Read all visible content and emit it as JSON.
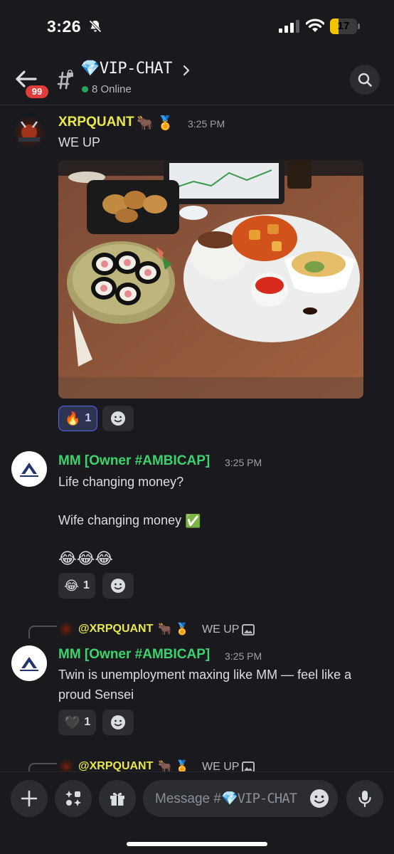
{
  "status_bar": {
    "time": "3:26",
    "battery_level": "17",
    "battery_fraction": 0.17
  },
  "header": {
    "unread_count": "99",
    "channel_name": "💎VIP-CHAT",
    "online_label": "8 Online"
  },
  "messages": [
    {
      "author": "XRPQUANT",
      "author_badges": "🐂 🏅",
      "time": "3:25 PM",
      "text": "WE UP",
      "attachment": "food-photo",
      "reactions": [
        {
          "emoji": "🔥",
          "count": "1",
          "active": true
        }
      ]
    },
    {
      "author": "MM [Owner #AMBICAP]",
      "time": "3:25 PM",
      "lines": [
        "Life changing money?",
        "Wife changing money",
        "😂😂😂"
      ],
      "line2_emoji": "✅",
      "reactions": [
        {
          "emoji": "😂",
          "count": "1",
          "active": false
        }
      ]
    },
    {
      "reply_to": {
        "author": "@XRPQUANT",
        "badges": "🐂 🏅",
        "text": "WE UP"
      },
      "author": "MM [Owner #AMBICAP]",
      "time": "3:25 PM",
      "lines": [
        "Twin is unemployment maxing like MM — feel like a",
        "proud Sensei"
      ],
      "reactions": [
        {
          "emoji": "🖤",
          "count": "1",
          "active": false
        }
      ]
    },
    {
      "reply_to": {
        "author": "@XRPQUANT",
        "badges": "🐂 🏅",
        "text": "WE UP"
      }
    }
  ],
  "composer": {
    "placeholder_lead": "Message #",
    "placeholder_channel": "💎VIP-CHAT"
  },
  "colors": {
    "background": "#1a1a1e",
    "accent": "#5865f2",
    "online": "#23a55a",
    "badge": "#e03c3c",
    "author_xrp": "#e8e84a",
    "author_mm": "#3ad36d"
  },
  "icons": [
    "bell-off-icon",
    "signal-icon",
    "wifi-icon",
    "battery-icon",
    "back-arrow-icon",
    "text-channel-icon",
    "chevron-right-icon",
    "search-icon",
    "add-reaction-icon",
    "image-icon",
    "plus-icon",
    "apps-icon",
    "gift-icon",
    "emoji-icon",
    "microphone-icon"
  ]
}
